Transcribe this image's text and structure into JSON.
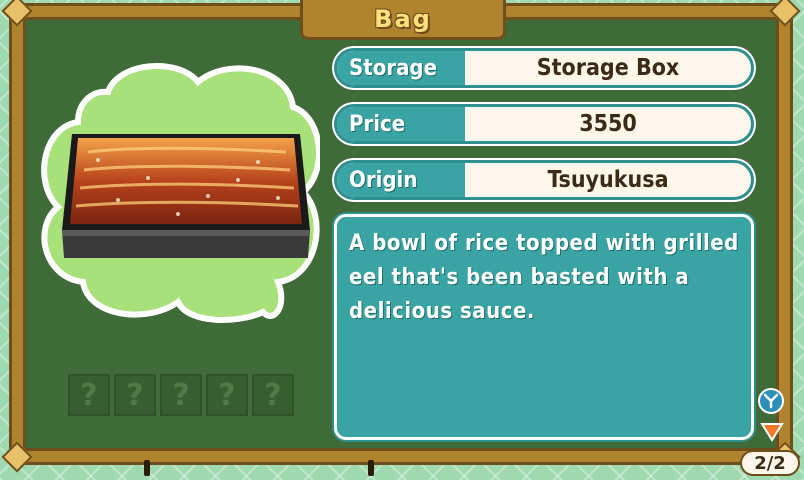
{
  "window": {
    "title": "Bag"
  },
  "item": {
    "fields": [
      {
        "label": "Storage",
        "value": "Storage Box"
      },
      {
        "label": "Price",
        "value": "3550"
      },
      {
        "label": "Origin",
        "value": "Tsuyukusa"
      }
    ],
    "description": "A bowl of rice topped with grilled eel that's been basted with a delicious sauce.",
    "image_icon": "unadon-eel-rice-box-icon"
  },
  "slots": [
    "?",
    "?",
    "?",
    "?",
    "?"
  ],
  "pager": {
    "label": "2/2"
  },
  "buttons": {
    "y_icon": "y-button-icon",
    "down_icon": "down-arrow-icon"
  },
  "colors": {
    "frame": "#b0832f",
    "panel": "#3f6b38",
    "accent": "#3aa3a3",
    "bubble": "#a8e07a"
  }
}
